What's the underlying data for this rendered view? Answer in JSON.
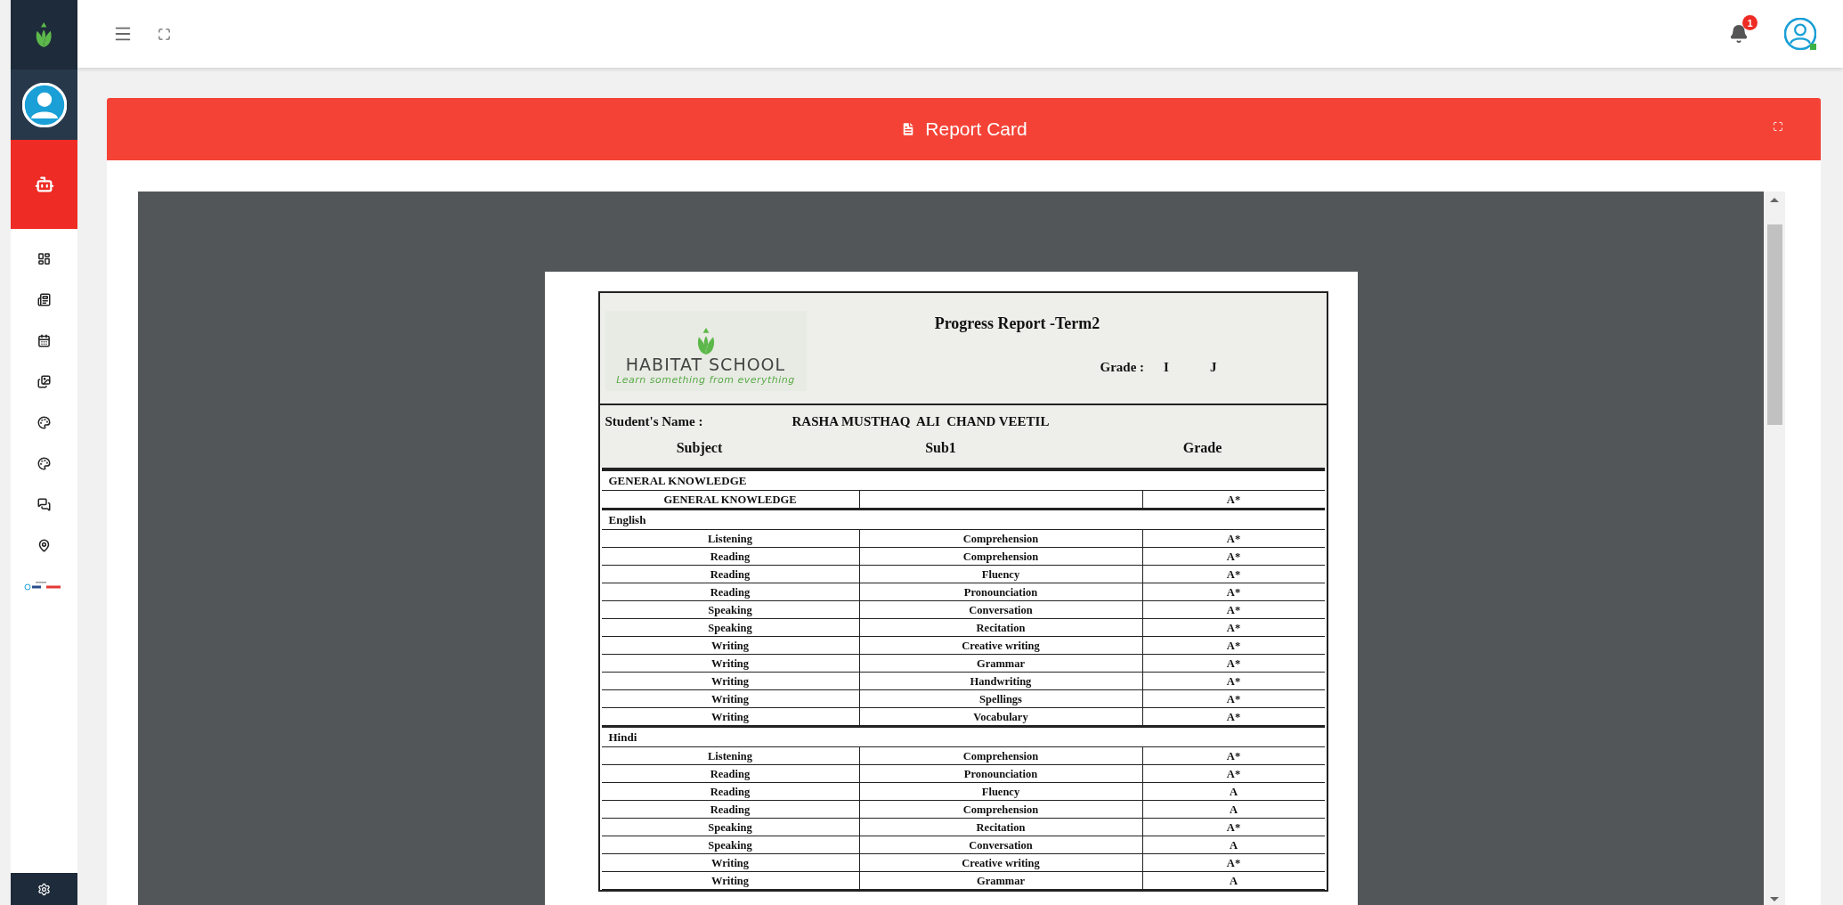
{
  "sidebar": {
    "items": [
      {
        "kind": "robot",
        "selected": true
      },
      {
        "kind": "dashboard",
        "selected": false
      },
      {
        "kind": "news",
        "selected": false
      },
      {
        "kind": "calendar",
        "selected": false
      },
      {
        "kind": "gallery",
        "selected": false
      },
      {
        "kind": "palette",
        "selected": false
      },
      {
        "kind": "palette",
        "selected": false
      },
      {
        "kind": "chat",
        "selected": false
      },
      {
        "kind": "location",
        "selected": false
      }
    ]
  },
  "topbar": {
    "notification_count": "1"
  },
  "panel": {
    "title": "Report Card"
  },
  "report": {
    "school_name": "HABITAT SCHOOL",
    "school_tagline": "Learn something from everything",
    "title": "Progress Report -Term2",
    "grade_label": "Grade :",
    "grade_value": "I",
    "section_value": "J",
    "student_label": "Student's Name :",
    "student_name": "RASHA MUSTHAQ  ALI  CHAND VEETIL",
    "columns": [
      "Subject",
      "Sub1",
      "Grade"
    ],
    "sections": [
      {
        "name": "GENERAL KNOWLEDGE",
        "rows": [
          [
            "GENERAL KNOWLEDGE",
            "",
            "A*"
          ]
        ]
      },
      {
        "name": "English",
        "rows": [
          [
            "Listening",
            "Comprehension",
            "A*"
          ],
          [
            "Reading",
            "Comprehension",
            "A*"
          ],
          [
            "Reading",
            "Fluency",
            "A*"
          ],
          [
            "Reading",
            "Pronounciation",
            "A*"
          ],
          [
            "Speaking",
            "Conversation",
            "A*"
          ],
          [
            "Speaking",
            "Recitation",
            "A*"
          ],
          [
            "Writing",
            "Creative writing",
            "A*"
          ],
          [
            "Writing",
            "Grammar",
            "A*"
          ],
          [
            "Writing",
            "Handwriting",
            "A*"
          ],
          [
            "Writing",
            "Spellings",
            "A*"
          ],
          [
            "Writing",
            "Vocabulary",
            "A*"
          ]
        ]
      },
      {
        "name": "Hindi",
        "rows": [
          [
            "Listening",
            "Comprehension",
            "A*"
          ],
          [
            "Reading",
            "Pronounciation",
            "A*"
          ],
          [
            "Reading",
            "Fluency",
            "A"
          ],
          [
            "Reading",
            "Comprehension",
            "A"
          ],
          [
            "Speaking",
            "Recitation",
            "A*"
          ],
          [
            "Speaking",
            "Conversation",
            "A"
          ],
          [
            "Writing",
            "Creative writing",
            "A*"
          ],
          [
            "Writing",
            "Grammar",
            "A"
          ]
        ]
      }
    ]
  }
}
